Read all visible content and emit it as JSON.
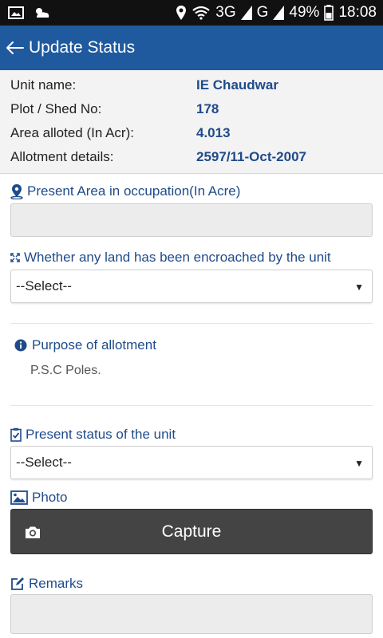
{
  "status_bar": {
    "network": "3G",
    "carrier_mode": "G",
    "battery": "49%",
    "time": "18:08"
  },
  "app_bar": {
    "title": "Update Status",
    "back_icon": "arrow-left-icon",
    "color": "#1f5a9e"
  },
  "unit_info": {
    "rows": [
      {
        "label": "Unit name:",
        "value": "IE Chaudwar"
      },
      {
        "label": "Plot / Shed No:",
        "value": "178"
      },
      {
        "label": "Area alloted (In Acr):",
        "value": "4.013"
      },
      {
        "label": "Allotment details:",
        "value": "2597/11-Oct-2007"
      }
    ]
  },
  "form": {
    "present_area": {
      "label": "Present Area in occupation(In Acre)",
      "value": "",
      "icon": "map-pin-icon"
    },
    "encroachment": {
      "label": "Whether any land has been encroached by the unit",
      "selected": "--Select--",
      "icon": "expand-arrows-icon"
    },
    "purpose": {
      "label": "Purpose of allotment",
      "value": "P.S.C Poles.",
      "icon": "info-icon"
    },
    "present_status": {
      "label": "Present status of the unit",
      "selected": "--Select--",
      "icon": "clipboard-check-icon"
    },
    "photo": {
      "label": "Photo",
      "button_label": "Capture",
      "icon": "image-icon",
      "button_icon": "camera-icon"
    },
    "remarks": {
      "label": "Remarks",
      "value": "",
      "icon": "edit-icon"
    }
  },
  "colors": {
    "accent": "#1f4b8a",
    "button": "#444444"
  }
}
